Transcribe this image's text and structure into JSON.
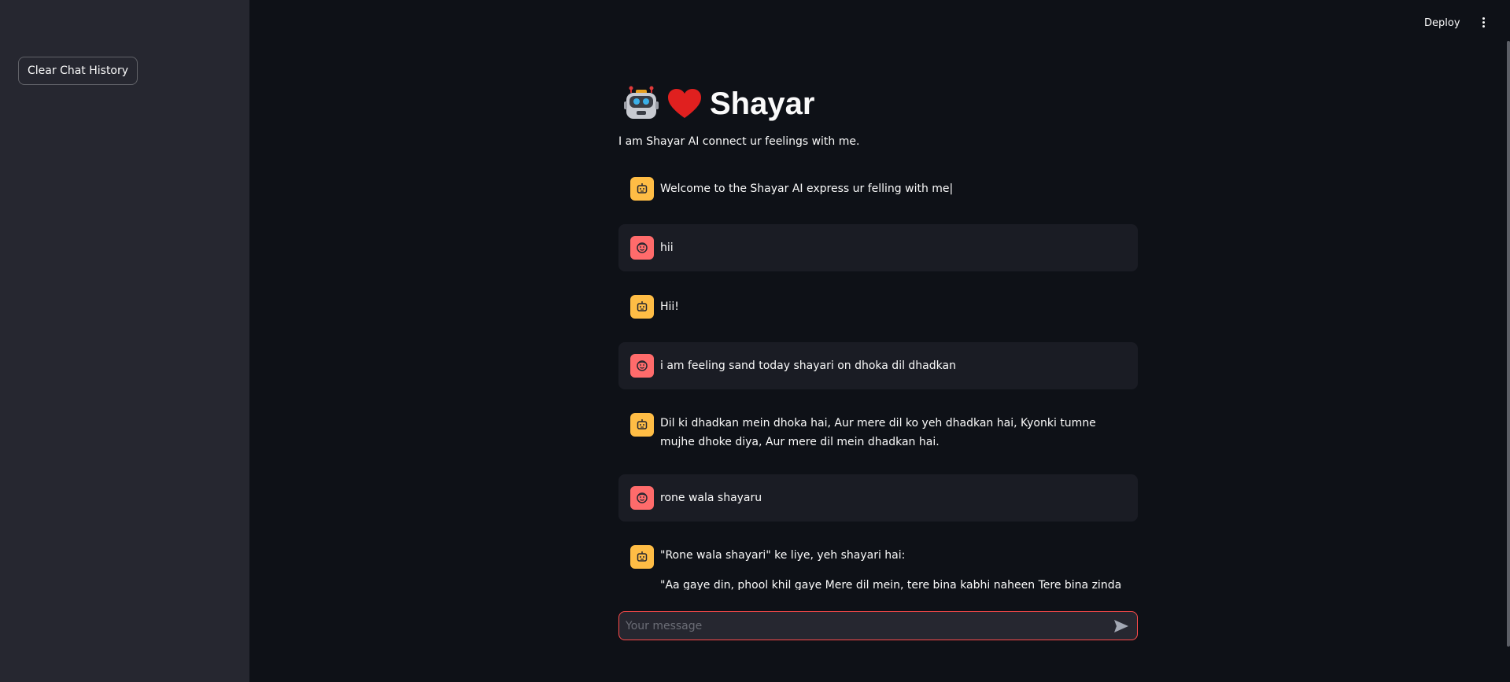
{
  "sidebar": {
    "clear_button": "Clear Chat History"
  },
  "topbar": {
    "deploy": "Deploy",
    "menu_icon": "more-vertical-icon"
  },
  "header": {
    "title": "Shayar",
    "subtitle": "I am Shayar AI connect ur feelings with me.",
    "icons": [
      "robot-emoji",
      "red-heart-emoji"
    ]
  },
  "messages": [
    {
      "role": "assistant",
      "text": "Welcome to the Shayar AI express ur felling with me|"
    },
    {
      "role": "user",
      "text": "hii"
    },
    {
      "role": "assistant",
      "text": "Hii!"
    },
    {
      "role": "user",
      "text": "i am feeling sand today shayari on dhoka dil dhadkan"
    },
    {
      "role": "assistant",
      "text": "Dil ki dhadkan mein dhoka hai, Aur mere dil ko yeh dhadkan hai, Kyonki tumne mujhe dhoke diya, Aur mere dil mein dhadkan hai."
    },
    {
      "role": "user",
      "text": "rone wala shayaru"
    },
    {
      "role": "assistant",
      "text": "\"Rone wala shayari\" ke liye, yeh shayari hai:",
      "text2": "\"Aa gaye din, phool khil gaye Mere dil mein, tere bina kabhi naheen Tere bina zindagi, kuch bhi"
    }
  ],
  "input": {
    "placeholder": "Your message",
    "value": ""
  },
  "colors": {
    "background": "#0e1117",
    "sidebar": "#262730",
    "assistant_avatar": "#ffbd45",
    "user_avatar": "#ff6b6b",
    "input_border": "#ff4b4b",
    "heart": "#e0201f"
  }
}
